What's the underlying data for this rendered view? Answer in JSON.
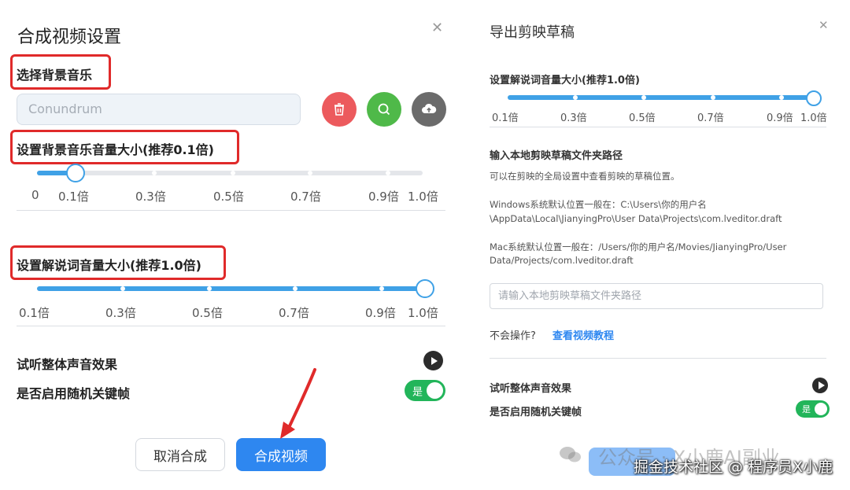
{
  "left_panel": {
    "title": "合成视频设置",
    "close_icon": "close-icon",
    "bg_music_label": "选择背景音乐",
    "music_input_value": "Conundrum",
    "icon_buttons": [
      {
        "icon": "trash-icon",
        "color": "#ec5a5d"
      },
      {
        "icon": "search-icon",
        "color": "#4fb949"
      },
      {
        "icon": "cloud-upload-icon",
        "color": "#6b6b6b"
      }
    ],
    "bg_volume_label": "设置背景音乐音量大小(推荐0.1倍)",
    "bg_volume_value": 0.1,
    "bg_volume_ticks": [
      "0",
      "0.1倍",
      "0.3倍",
      "0.5倍",
      "0.7倍",
      "0.9倍",
      "1.0倍"
    ],
    "narration_label": "设置解说词音量大小(推荐1.0倍)",
    "narration_value": 1.0,
    "narration_ticks": [
      "0.1倍",
      "0.3倍",
      "0.5倍",
      "0.7倍",
      "0.9倍",
      "1.0倍"
    ],
    "preview_label": "试听整体声音效果",
    "random_keyframe_label": "是否启用随机关键帧",
    "toggle_text": "是",
    "cancel_button": "取消合成",
    "confirm_button": "合成视频"
  },
  "right_panel": {
    "title": "导出剪映草稿",
    "close_icon": "close-icon",
    "narration_label": "设置解说词音量大小(推荐1.0倍)",
    "narration_value": 1.0,
    "narration_ticks": [
      "0.1倍",
      "0.3倍",
      "0.5倍",
      "0.7倍",
      "0.9倍",
      "1.0倍"
    ],
    "draft_path_label": "输入本地剪映草稿文件夹路径",
    "hint": "可以在剪映的全局设置中查看剪映的草稿位置。",
    "windows_line1": "Windows系统默认位置一般在：C:\\Users\\你的用户名",
    "windows_line2": "\\AppData\\Local\\JianyingPro\\User Data\\Projects\\com.lveditor.draft",
    "mac_line1": "Mac系统默认位置一般在：/Users/你的用户名/Movies/JianyingPro/User",
    "mac_line2": "Data/Projects/com.lveditor.draft",
    "path_placeholder": "请输入本地剪映草稿文件夹路径",
    "help_question": "不会操作?",
    "help_link": "查看视频教程",
    "preview_label": "试听整体声音效果",
    "random_keyframe_label": "是否启用随机关键帧",
    "toggle_text": "是"
  },
  "watermark": {
    "faint_text": "公众号 · X小鹿AI副业",
    "main_text": "掘金技术社区 @ 程序员X小鹿"
  },
  "colors": {
    "slider_blue": "#3fa1e6",
    "track_grey": "#e4e6ea",
    "primary": "#2e87f0",
    "toggle_green": "#22b55a",
    "highlight_red": "#e02a2a"
  }
}
